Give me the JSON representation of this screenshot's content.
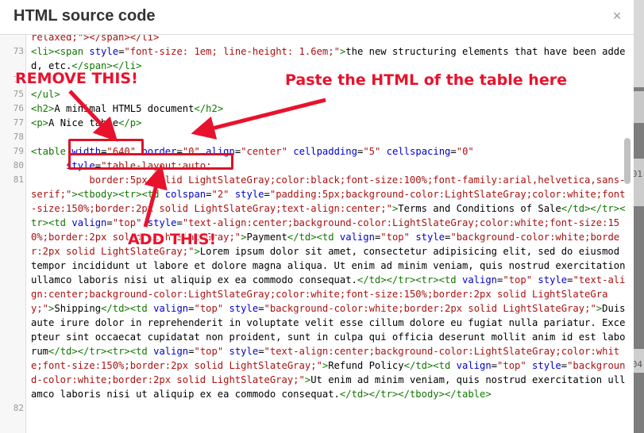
{
  "dialog": {
    "title": "HTML source code",
    "close_label": "×"
  },
  "background": {
    "numbers": [
      "01",
      "04"
    ]
  },
  "annotations": {
    "remove": "REMOVE THIS!",
    "paste": "Paste the HTML of the table here",
    "add": "ADD THIS!"
  },
  "colors": {
    "annotation": "#e8122d",
    "tag": "#117700",
    "attribute": "#0000cc",
    "string": "#aa1111"
  },
  "code": {
    "line72_tail": "relaxed;\"></span></li>",
    "line73": {
      "num": "73",
      "t1": "<li>",
      "t2": "<span",
      "a1": " style",
      "p1": "=",
      "s1": "\"font-size: 1em; line-height: 1.6em;\"",
      "t3": ">",
      "p2": "the new structuring elements that have been added, etc.",
      "t4": "</span></li>"
    },
    "line74": {
      "num": "74"
    },
    "line75": {
      "num": "75",
      "t1": "</ul>"
    },
    "line76": {
      "num": "76",
      "t1": "<h2>",
      "p1": "A minimal HTML5 document",
      "t2": "</h2>"
    },
    "line77": {
      "num": "77",
      "t1": "<p>",
      "p1": "A Nice table",
      "t2": "</p>"
    },
    "line78": {
      "num": "78"
    },
    "line79": {
      "num": "79",
      "t1": "<table",
      "a1": " width",
      "s1": "\"640\"",
      "a2": " border",
      "s2": "\"0\"",
      "a3": " align",
      "s3": "\"center\"",
      "a4": " cellpadding",
      "s4": "\"5\"",
      "a5": " cellspacing",
      "s5": "\"0\""
    },
    "line80": {
      "num": "80",
      "a1": "style",
      "s1": "\"table-layout:auto;"
    },
    "line81": {
      "num": "81",
      "s1": "          border:5px solid LightSlateGray;color:black;font-size:100%;font-family:arial,helvetica,sans-serif;\"",
      "t1": "><tbody><tr><td",
      "a1": " colspan",
      "s2": "\"2\"",
      "a2": " style",
      "s3": "\"padding:5px;background-color:LightSlateGray;color:white;font-size:150%;border:2px solid LightSlateGray;text-align:center;\"",
      "t2": ">",
      "p1": "Terms and Conditions of Sale",
      "t3": "</td></tr><tr><td",
      "a3": " valign",
      "s4": "\"top\"",
      "a4": " style",
      "s5": "\"text-align:center;background-color:LightSlateGray;color:white;font-size:150%;border:2px solid LightSlateGray;\"",
      "t4": ">",
      "p2": "Payment",
      "t5": "</td><td",
      "a5": " valign",
      "s6": "\"top\"",
      "a6": " style",
      "s7": "\"background-color:white;border:2px solid LightSlateGray;\"",
      "t6": ">",
      "p3": "Lorem ipsum dolor sit amet, consectetur adipisicing elit, sed do eiusmod tempor incididunt ut labore et dolore magna aliqua. Ut enim ad minim veniam, quis nostrud exercitation ullamco laboris nisi ut aliquip ex ea commodo consequat.",
      "t7": "</td></tr><tr><td",
      "a7": " valign",
      "s8": "\"top\"",
      "a8": " style",
      "s9": "\"text-align:center;background-color:LightSlateGray;color:white;font-size:150%;border:2px solid LightSlateGray;\"",
      "t8": ">",
      "p4": "Shipping",
      "t9": "</td><td",
      "a9": " valign",
      "s10": "\"top\"",
      "a10": " style",
      "s11": "\"background-color:white;border:2px solid LightSlateGray;\"",
      "t10": ">",
      "p5": "Duis aute irure dolor in reprehenderit in voluptate velit esse cillum dolore eu fugiat nulla pariatur. Excepteur sint occaecat cupidatat non proident, sunt in culpa qui officia deserunt mollit anim id est laborum",
      "t11": "</td></tr><tr><td",
      "a11": " valign",
      "s12": "\"top\"",
      "a12": " style",
      "s13": "\"text-align:center;background-color:LightSlateGray;color:white;font-size:150%;border:2px solid LightSlateGray;\"",
      "t12": ">",
      "p6": "Refund Policy",
      "t13": "</td><td",
      "a13": " valign",
      "s14": "\"top\"",
      "a14": " style",
      "s15": "\"background-color:white;border:2px solid LightSlateGray;\"",
      "t14": ">",
      "p7": "Ut enim ad minim veniam, quis nostrud exercitation ullamco laboris nisi ut aliquip ex ea commodo consequat.",
      "t15": "</td></tr></tbody></table>"
    },
    "line82": {
      "num": "82"
    },
    "equals": "="
  }
}
